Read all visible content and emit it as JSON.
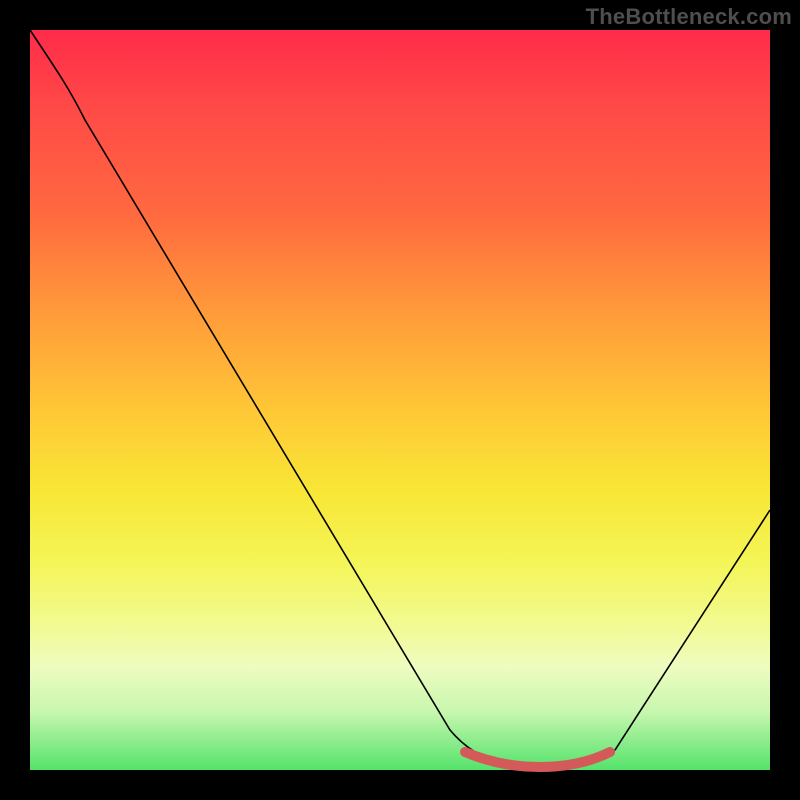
{
  "watermark": "TheBottleneck.com",
  "chart_data": {
    "type": "line",
    "title": "",
    "xlabel": "",
    "ylabel": "",
    "xlim": [
      0,
      100
    ],
    "ylim": [
      0,
      100
    ],
    "grid": false,
    "series": [
      {
        "name": "curve",
        "x": [
          0,
          6,
          12,
          20,
          30,
          40,
          50,
          58,
          62,
          68,
          74,
          78,
          82,
          88,
          94,
          100
        ],
        "y": [
          100,
          92,
          85,
          74,
          60,
          46,
          32,
          20,
          12,
          3,
          0,
          0,
          2,
          10,
          22,
          35
        ]
      }
    ],
    "highlight": {
      "name": "valley",
      "x": [
        62,
        68,
        74,
        78
      ],
      "y": [
        2.5,
        0.5,
        0.5,
        2.5
      ]
    }
  }
}
